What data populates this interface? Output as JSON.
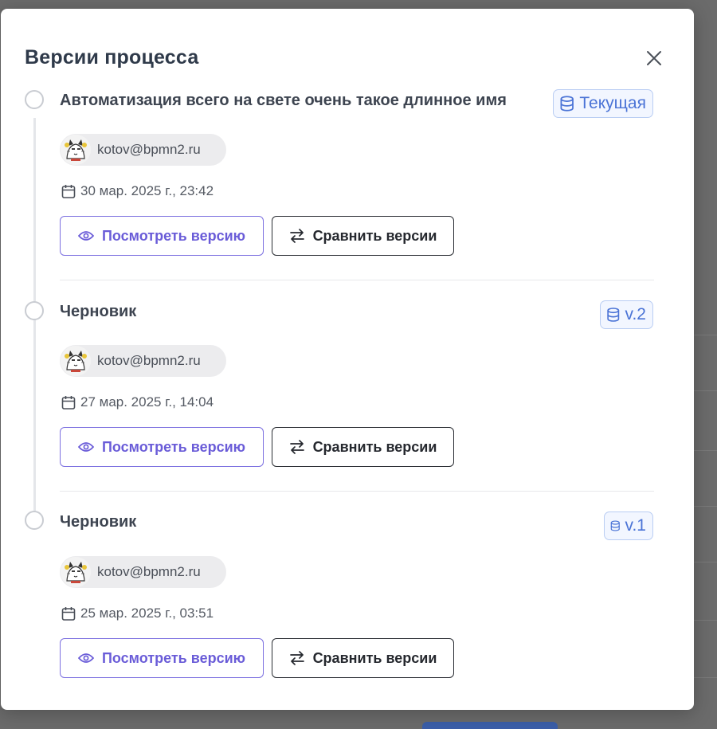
{
  "modal": {
    "title": "Версии процесса",
    "close_icon": "close-icon"
  },
  "colors": {
    "badge_text": "#4a73d6",
    "view_button": "#6a5cd8",
    "title": "#2f3a4a"
  },
  "versions": [
    {
      "name": "Автоматизация всего на свете очень такое длинное имя",
      "badge": "Текущая",
      "badge_icon": "database-icon",
      "user_email": "kotov@bpmn2.ru",
      "date": "30 мар. 2025 г., 23:42",
      "view_label": "Посмотреть версию",
      "compare_label": "Сравнить версии"
    },
    {
      "name": "Черновик",
      "badge": "v.2",
      "badge_icon": "database-icon",
      "user_email": "kotov@bpmn2.ru",
      "date": "27 мар. 2025 г., 14:04",
      "view_label": "Посмотреть версию",
      "compare_label": "Сравнить версии"
    },
    {
      "name": "Черновик",
      "badge": "v.1",
      "badge_icon": "database-icon",
      "user_email": "kotov@bpmn2.ru",
      "date": "25 мар. 2025 г., 03:51",
      "view_label": "Посмотреть версию",
      "compare_label": "Сравнить версии"
    }
  ]
}
